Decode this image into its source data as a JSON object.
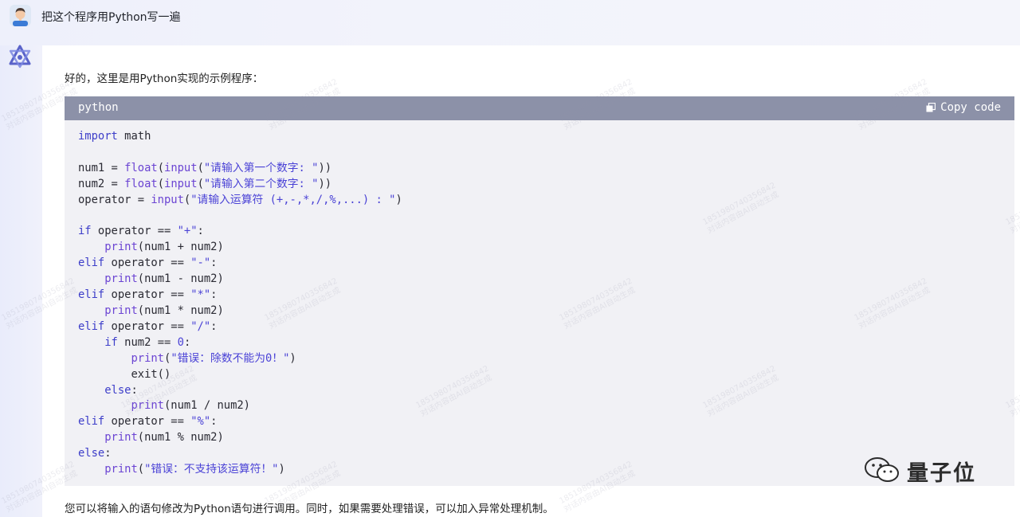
{
  "user": {
    "message": "把这个程序用Python写一遍",
    "avatar_icon": "user-avatar"
  },
  "assistant": {
    "icon": "assistant-logo-icon",
    "intro": "好的，这里是用Python实现的示例程序：",
    "outro": "您可以将输入的语句修改为Python语句进行调用。同时，如果需要处理错误，可以加入异常处理机制。"
  },
  "codeblock": {
    "language": "python",
    "copy_label": "Copy code",
    "copy_icon": "copy-icon",
    "header_color": "#8c91a8",
    "lines": [
      "import math",
      "",
      "num1 = float(input(\"请输入第一个数字: \"))",
      "num2 = float(input(\"请输入第二个数字: \"))",
      "operator = input(\"请输入运算符 (+,-,*,/,%,...) : \")",
      "",
      "if operator == \"+\":",
      "    print(num1 + num2)",
      "elif operator == \"-\":",
      "    print(num1 - num2)",
      "elif operator == \"*\":",
      "    print(num1 * num2)",
      "elif operator == \"/\":",
      "    if num2 == 0:",
      "        print(\"错误：除数不能为0！\")",
      "        exit()",
      "    else:",
      "        print(num1 / num2)",
      "elif operator == \"%\":",
      "    print(num1 % num2)",
      "else:",
      "    print(\"错误：不支持该运算符！\")"
    ]
  },
  "watermark": {
    "line1": "18519807403568​42",
    "line2": "对话内容由AI自动生成",
    "brand": "量子位",
    "brand_icon": "wechat-icon"
  }
}
